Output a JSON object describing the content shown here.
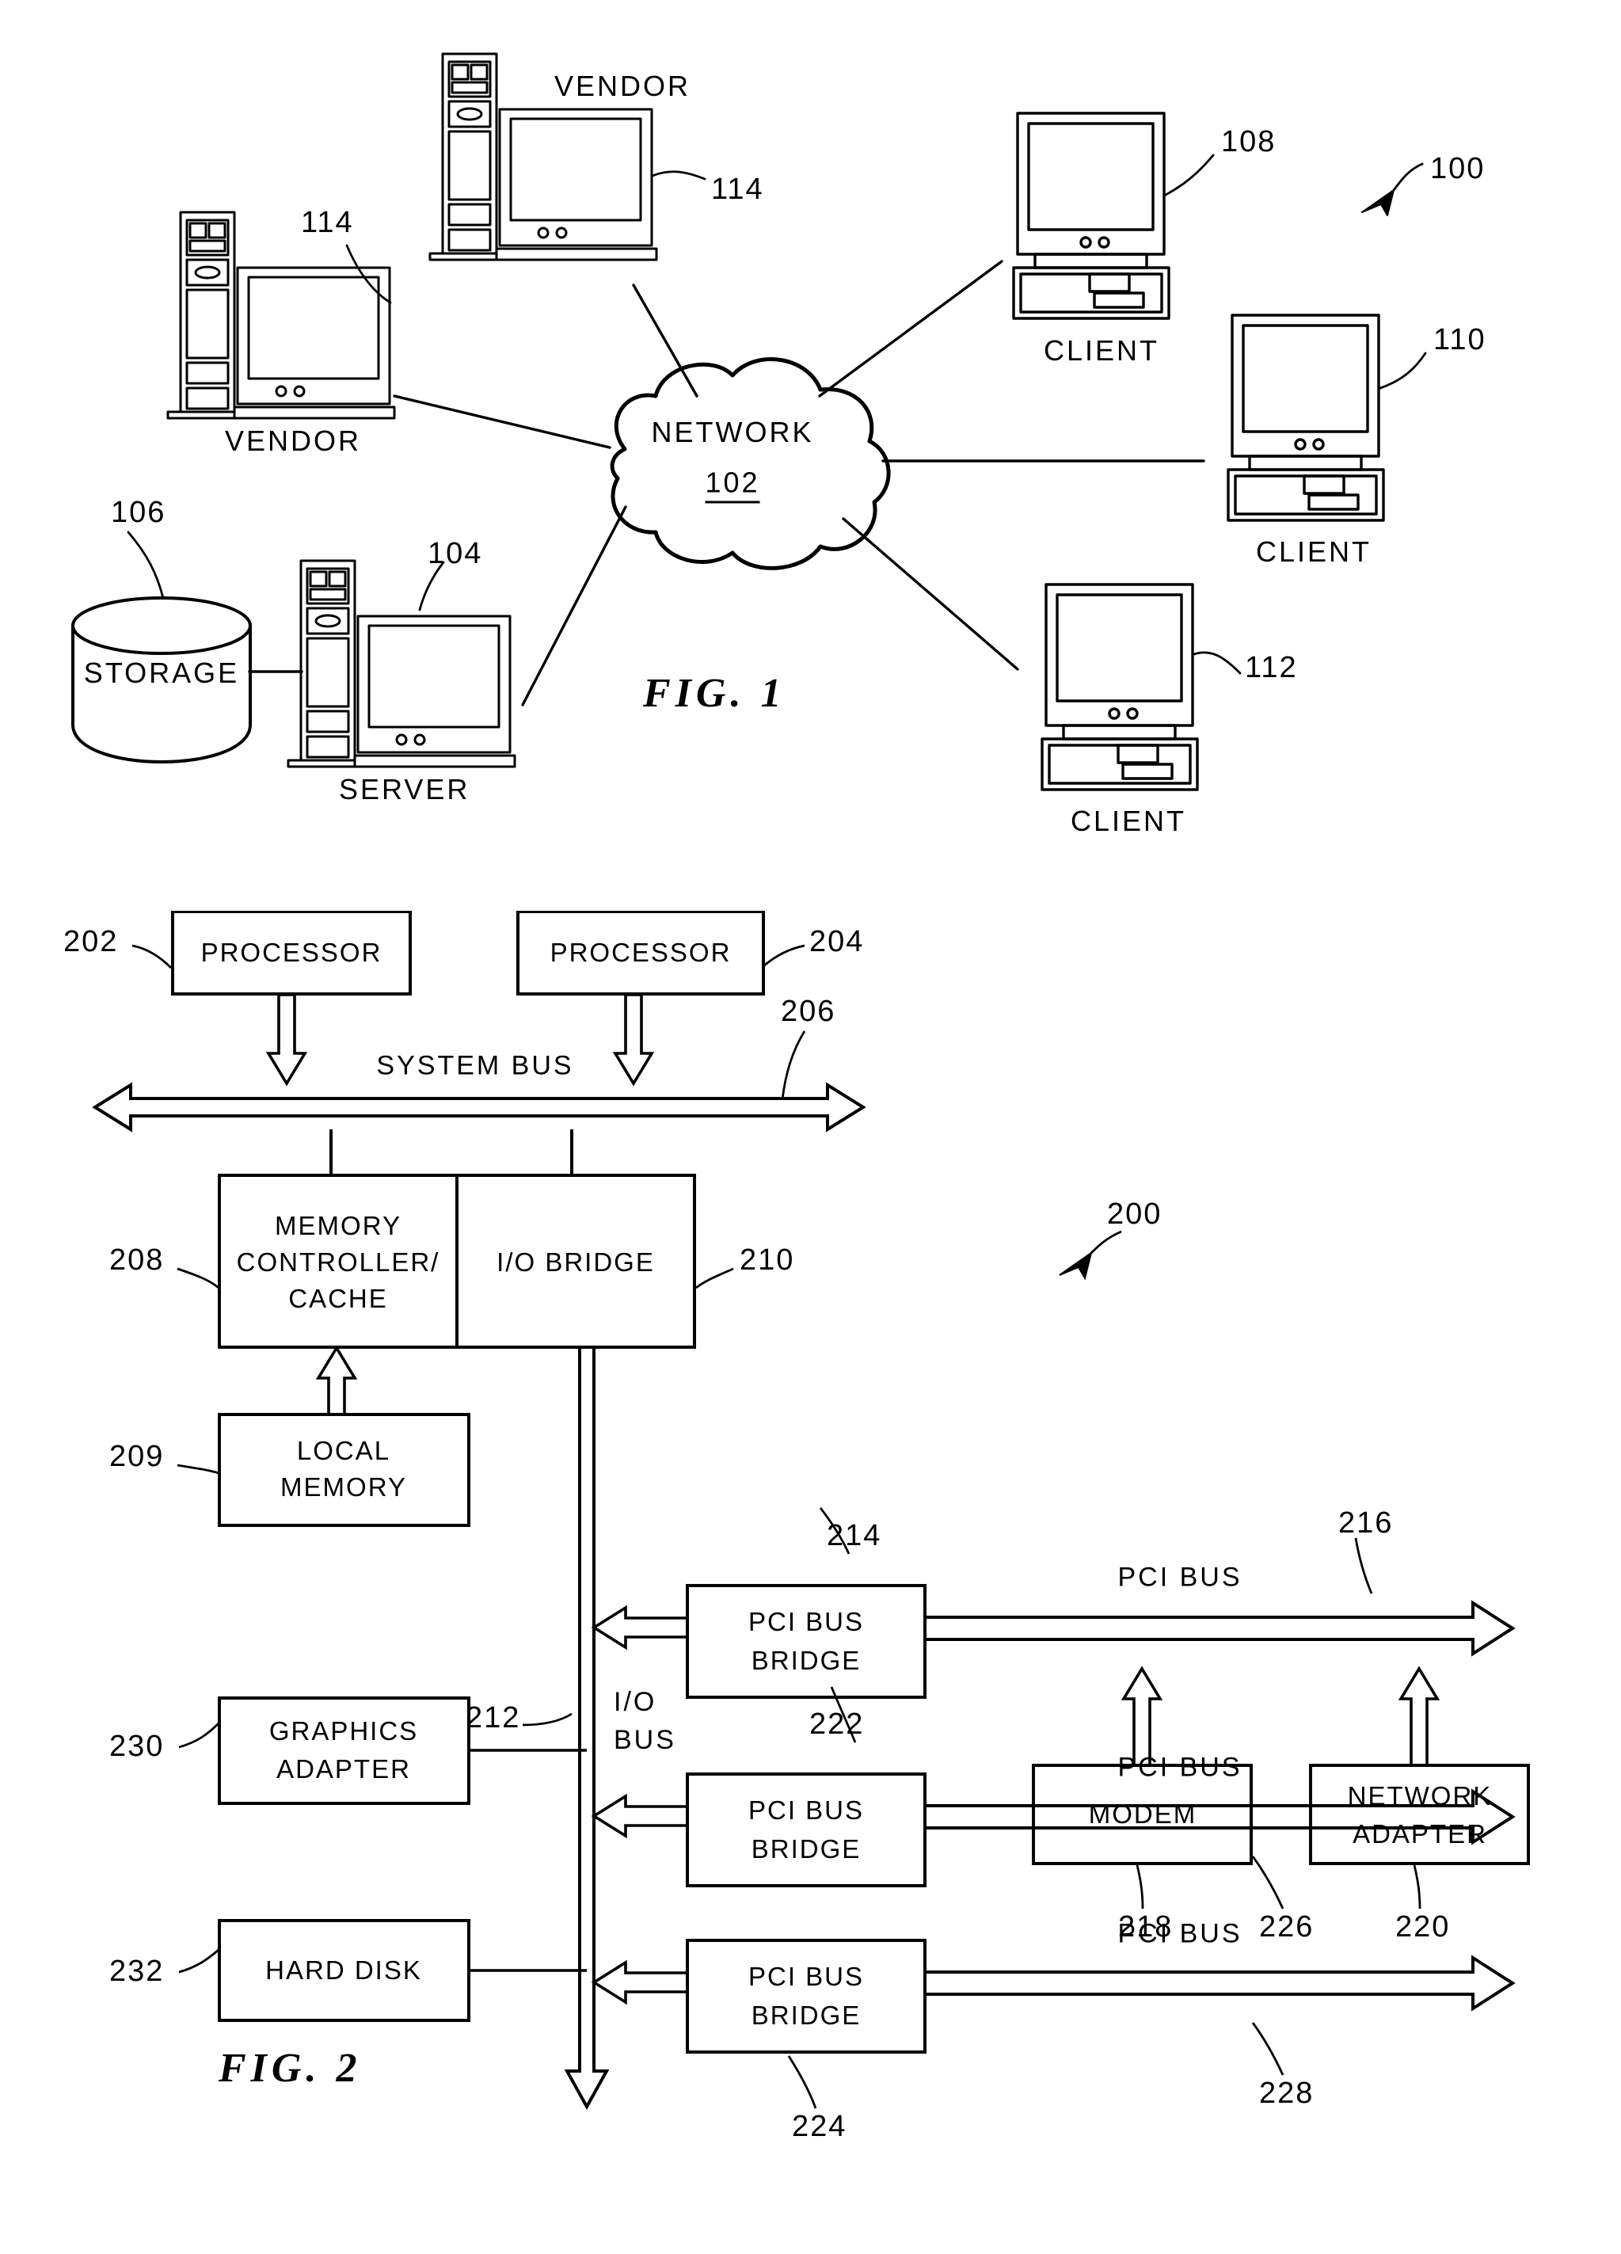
{
  "figures": [
    {
      "id": "fig1",
      "caption": "FIG.  1",
      "system_ref": "100",
      "network": {
        "label": "NETWORK",
        "ref": "102"
      },
      "nodes": [
        {
          "name": "vendor-1",
          "label": "VENDOR",
          "ref": "114",
          "type": "workstation"
        },
        {
          "name": "vendor-2",
          "label": "VENDOR",
          "ref": "114",
          "type": "workstation"
        },
        {
          "name": "server",
          "label": "SERVER",
          "ref": "104",
          "type": "workstation"
        },
        {
          "name": "storage",
          "label": "STORAGE",
          "ref": "106",
          "type": "cylinder"
        },
        {
          "name": "client-1",
          "label": "CLIENT",
          "ref": "108",
          "type": "desktop"
        },
        {
          "name": "client-2",
          "label": "CLIENT",
          "ref": "110",
          "type": "desktop"
        },
        {
          "name": "client-3",
          "label": "CLIENT",
          "ref": "112",
          "type": "desktop"
        }
      ]
    },
    {
      "id": "fig2",
      "caption": "FIG.  2",
      "system_ref": "200",
      "blocks": [
        {
          "name": "processor-1",
          "label": "PROCESSOR",
          "ref": "202"
        },
        {
          "name": "processor-2",
          "label": "PROCESSOR",
          "ref": "204"
        },
        {
          "name": "memory-controller",
          "label": "MEMORY\nCONTROLLER/\nCACHE",
          "ref": "208"
        },
        {
          "name": "io-bridge",
          "label": "I/O  BRIDGE",
          "ref": "210"
        },
        {
          "name": "local-memory",
          "label": "LOCAL\nMEMORY",
          "ref": "209"
        },
        {
          "name": "graphics-adapter",
          "label": "GRAPHICS\nADAPTER",
          "ref": "230"
        },
        {
          "name": "hard-disk",
          "label": "HARD  DISK",
          "ref": "232"
        },
        {
          "name": "pci-bus-bridge-1",
          "label": "PCI BUS\nBRIDGE",
          "ref": "214"
        },
        {
          "name": "pci-bus-bridge-2",
          "label": "PCI BUS\nBRIDGE",
          "ref": "222"
        },
        {
          "name": "pci-bus-bridge-3",
          "label": "PCI BUS\nBRIDGE",
          "ref": "224"
        },
        {
          "name": "modem",
          "label": "MODEM",
          "ref": "218"
        },
        {
          "name": "network-adapter",
          "label": "NETWORK\nADAPTER",
          "ref": "220"
        }
      ],
      "buses": [
        {
          "name": "system-bus",
          "label": "SYSTEM BUS",
          "ref": "206"
        },
        {
          "name": "io-bus",
          "label": "I/O\nBUS",
          "ref": "212"
        },
        {
          "name": "pci-bus-1",
          "label": "PCI BUS",
          "ref": "216"
        },
        {
          "name": "pci-bus-2",
          "label": "PCI BUS",
          "ref": "226"
        },
        {
          "name": "pci-bus-3",
          "label": "PCI BUS",
          "ref": "228"
        }
      ]
    }
  ],
  "text": {
    "vendor": "VENDOR",
    "client": "CLIENT",
    "server": "SERVER",
    "storage": "STORAGE",
    "network": "NETWORK",
    "network_ref": "102",
    "ref_100": "100",
    "ref_104": "104",
    "ref_106": "106",
    "ref_108": "108",
    "ref_110": "110",
    "ref_112": "112",
    "ref_114a": "114",
    "ref_114b": "114",
    "fig1": "FIG.  1",
    "fig2": "FIG.  2",
    "processor": "PROCESSOR",
    "ref_200": "200",
    "ref_202": "202",
    "ref_204": "204",
    "ref_206": "206",
    "ref_208": "208",
    "ref_209": "209",
    "ref_210": "210",
    "ref_212": "212",
    "ref_214": "214",
    "ref_216": "216",
    "ref_218": "218",
    "ref_220": "220",
    "ref_222": "222",
    "ref_224": "224",
    "ref_226": "226",
    "ref_228": "228",
    "ref_230": "230",
    "ref_232": "232",
    "system_bus": "SYSTEM BUS",
    "memory_controller_l1": "MEMORY",
    "memory_controller_l2": "CONTROLLER/",
    "memory_controller_l3": "CACHE",
    "io_bridge": "I/O  BRIDGE",
    "local_memory_l1": "LOCAL",
    "local_memory_l2": "MEMORY",
    "io_bus_l1": "I/O",
    "io_bus_l2": "BUS",
    "graphics_l1": "GRAPHICS",
    "graphics_l2": "ADAPTER",
    "hard_disk": "HARD  DISK",
    "pci_bus_bridge_l1": "PCI BUS",
    "pci_bus_bridge_l2": "BRIDGE",
    "pci_bus": "PCI BUS",
    "modem": "MODEM",
    "network_adapter_l1": "NETWORK",
    "network_adapter_l2": "ADAPTER"
  }
}
